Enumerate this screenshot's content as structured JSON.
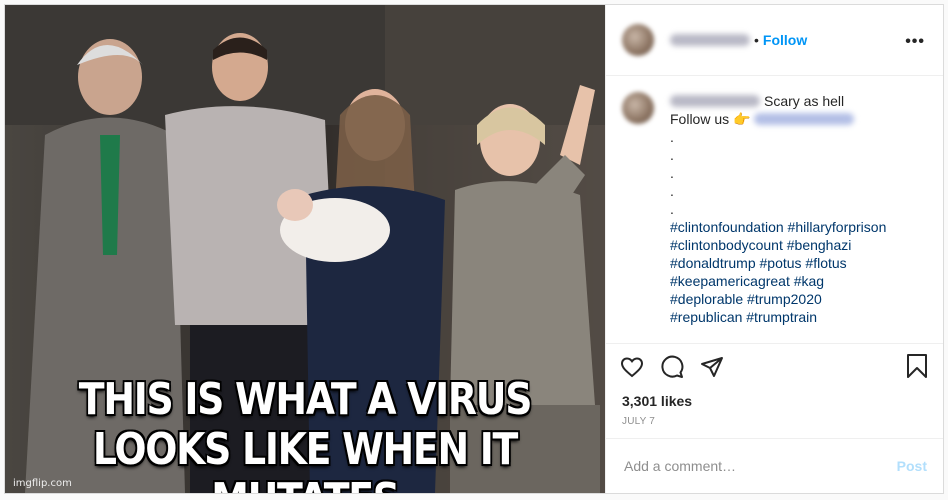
{
  "media": {
    "caption_line1": "THIS IS WHAT A VIRUS",
    "caption_line2": "LOOKS LIKE WHEN IT MUTATES",
    "watermark": "imgflip.com"
  },
  "header": {
    "separator": "•",
    "follow_label": "Follow",
    "more_icon": "more-horizontal-icon"
  },
  "caption": {
    "text": "Scary as hell",
    "follow_us": "Follow us",
    "emoji": "👉",
    "dots": [
      ".",
      ".",
      ".",
      ".",
      "."
    ],
    "hashtags": [
      "#clintonfoundation #hillaryforprison",
      "#clintonbodycount #benghazi",
      "#donaldtrump #potus #flotus",
      "#keepamericagreat #kag",
      "#deplorable #trump2020",
      "#republican #trumptrain"
    ]
  },
  "actions": {
    "icons": [
      "heart-icon",
      "comment-icon",
      "share-icon",
      "bookmark-icon"
    ]
  },
  "likes": "3,301 likes",
  "date": "JULY 7",
  "comment_input": {
    "placeholder": "Add a comment…",
    "post_label": "Post"
  },
  "colors": {
    "link_blue": "#0095f6",
    "hashtag_blue": "#00376b",
    "post_disabled": "#b2dffc",
    "border": "#dbdbdb"
  }
}
